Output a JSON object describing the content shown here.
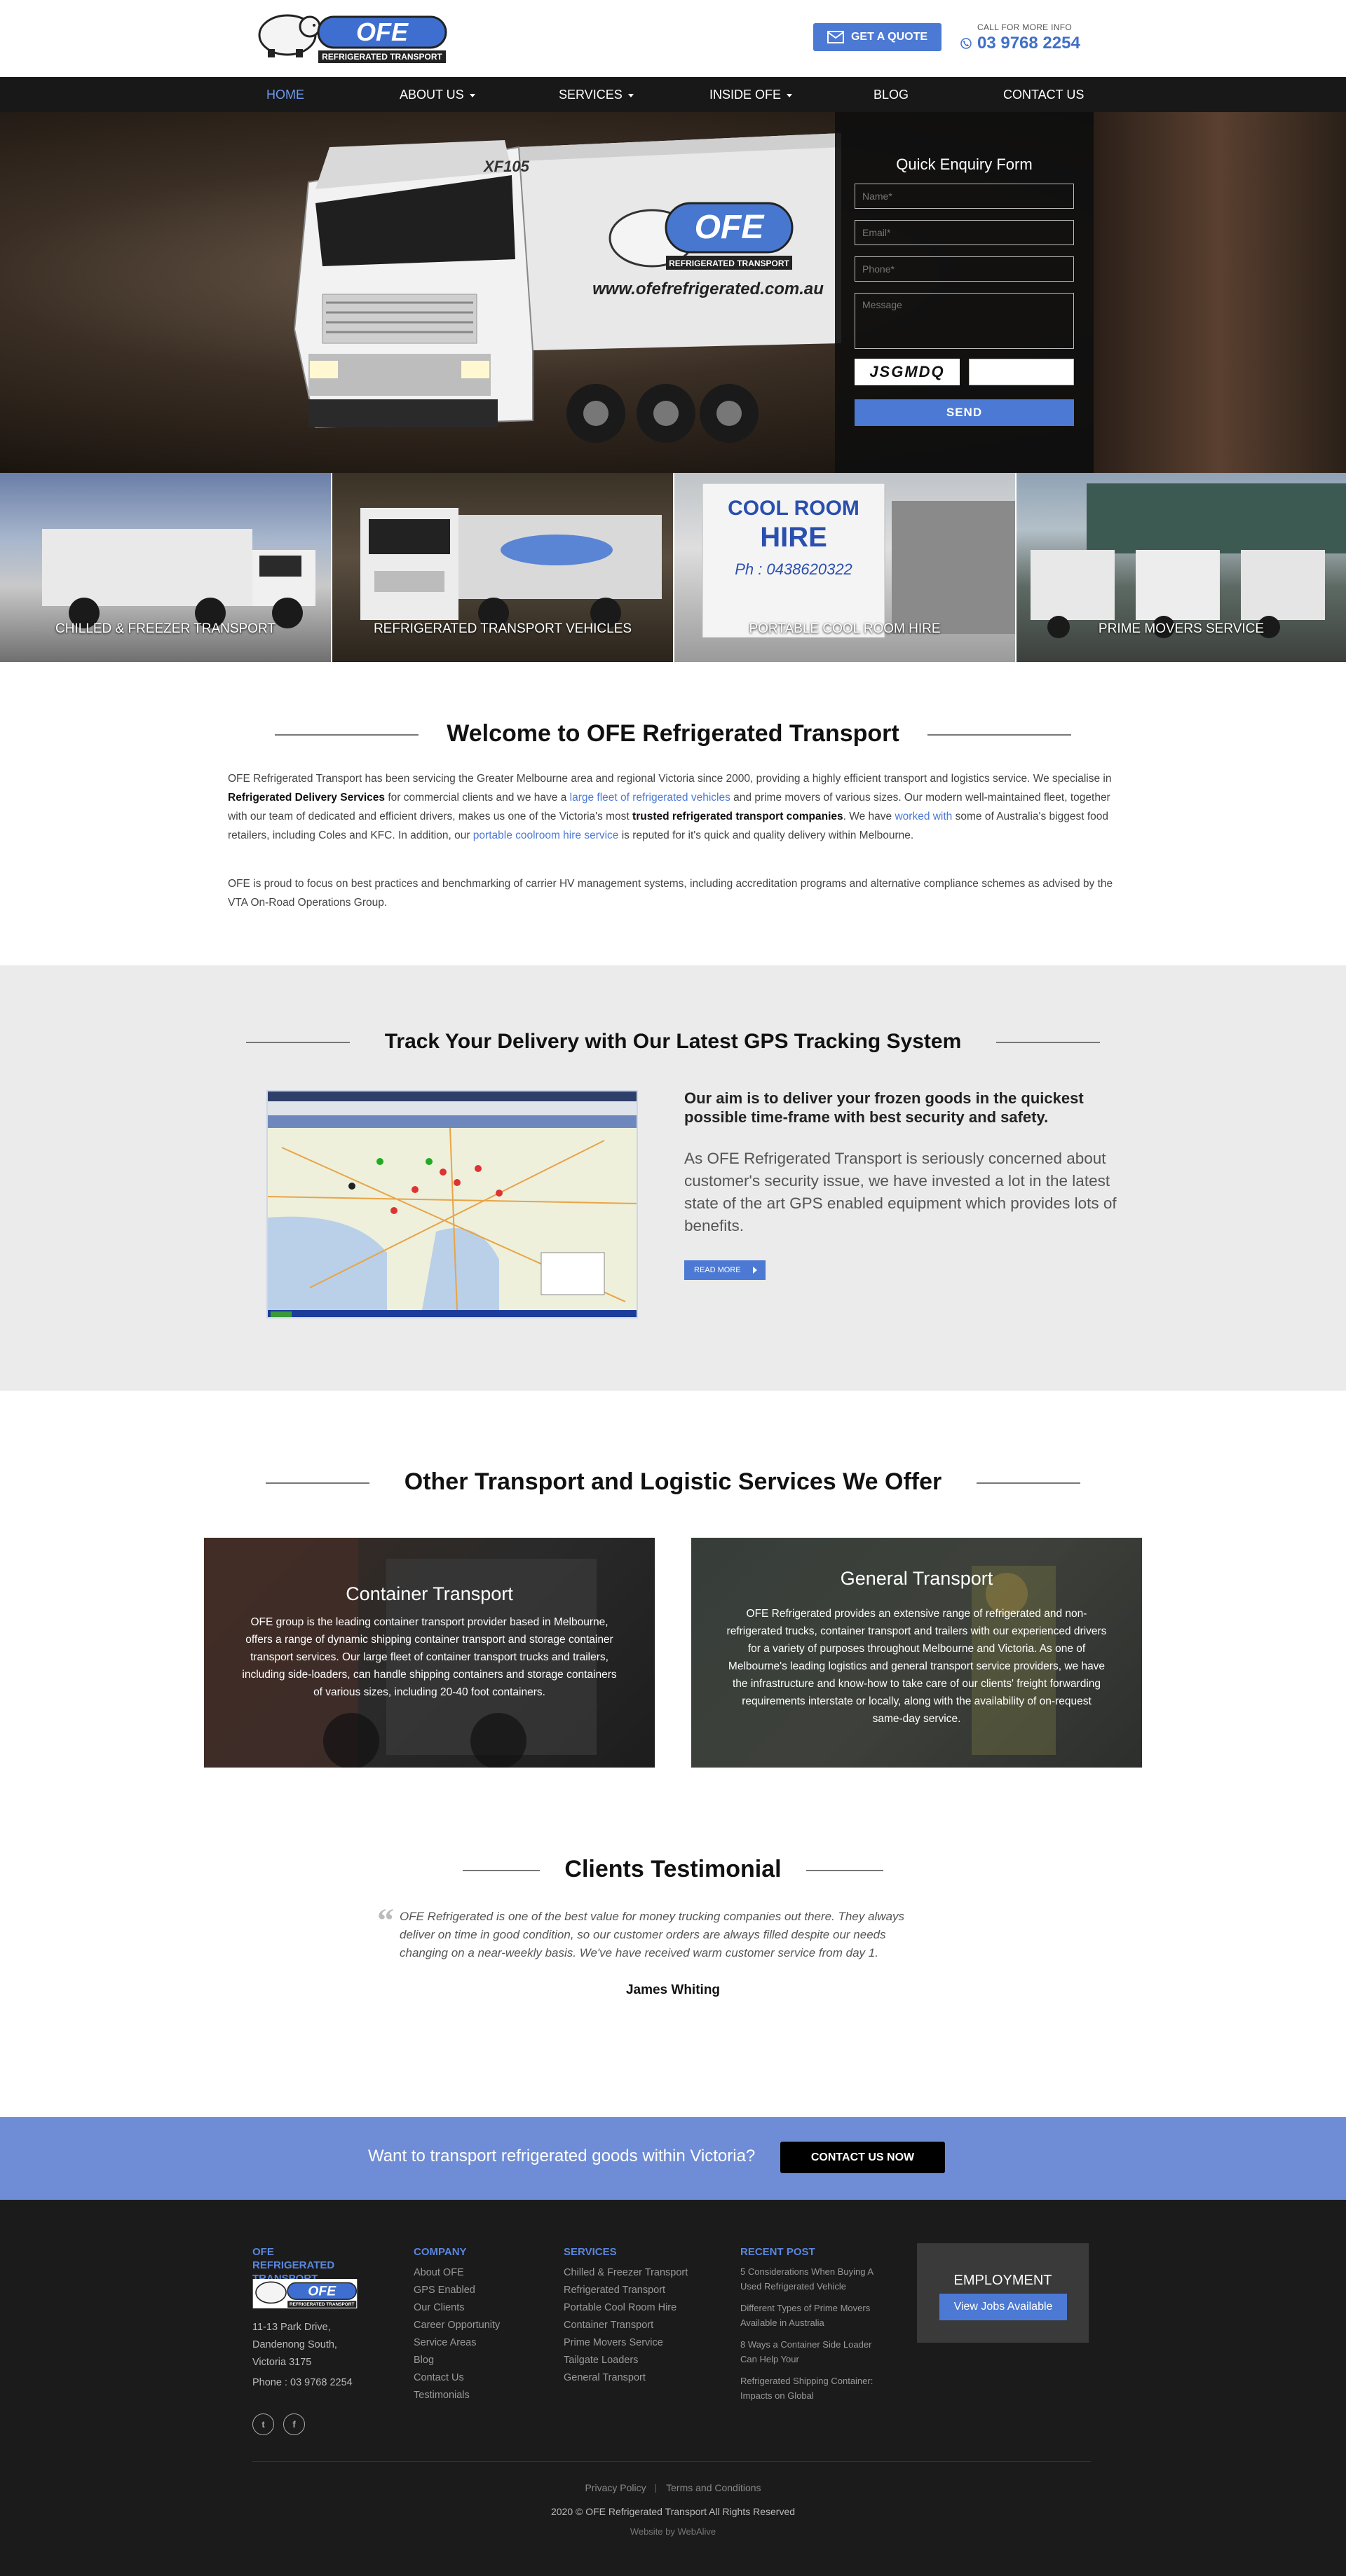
{
  "header": {
    "logo_text": "OFE",
    "logo_sub": "REFRIGERATED TRANSPORT",
    "quote_button": "GET A QUOTE",
    "call_label": "CALL FOR MORE INFO",
    "phone": "03 9768 2254"
  },
  "nav": {
    "items": [
      {
        "label": "HOME"
      },
      {
        "label": "ABOUT US"
      },
      {
        "label": "SERVICES"
      },
      {
        "label": "INSIDE OFE"
      },
      {
        "label": "BLOG"
      },
      {
        "label": "CONTACT US"
      }
    ]
  },
  "hero": {
    "truck_model": "XF105",
    "truck_url": "www.ofefrefrigerated.com.au",
    "enquiry": {
      "title": "Quick Enquiry Form",
      "name_placeholder": "Name*",
      "email_placeholder": "Email*",
      "phone_placeholder": "Phone*",
      "message_placeholder": "Message",
      "captcha": "JSGMDQ",
      "send_label": "SEND"
    }
  },
  "tiles": [
    {
      "label": "CHILLED & FREEZER TRANSPORT"
    },
    {
      "label": "REFRIGERATED TRANSPORT VEHICLES"
    },
    {
      "label": "PORTABLE COOL ROOM HIRE",
      "sign_title": "COOL ROOM",
      "sign_sub": "HIRE",
      "sign_phone": "Ph : 0438620322"
    },
    {
      "label": "PRIME MOVERS SERVICE"
    }
  ],
  "welcome": {
    "title": "Welcome to OFE Refrigerated Transport",
    "p1_a": "OFE Refrigerated Transport has been servicing the Greater Melbourne area and regional Victoria since 2000, providing a highly efficient transport and logistics service. We specialise in ",
    "p1_b": "Refrigerated Delivery Services",
    "p1_c": " for commercial clients and we have a ",
    "p1_link1": "large fleet of refrigerated vehicles",
    "p1_d": " and prime movers of various sizes. Our modern well-maintained fleet, together with our team of dedicated and efficient drivers, makes us one of the Victoria's most ",
    "p1_e": "trusted refrigerated transport companies",
    "p1_f": ". We have ",
    "p1_link2": "worked with",
    "p1_g": " some of Australia's biggest food retailers, including Coles and KFC. In addition, our ",
    "p1_link3": "portable coolroom hire service",
    "p1_h": " is reputed for it's quick and quality delivery within Melbourne.",
    "p2": "OFE is proud to focus on best practices and benchmarking of carrier HV management systems, including accreditation programs and alternative compliance schemes as advised by the VTA On-Road Operations Group."
  },
  "gps": {
    "title": "Track Your Delivery with Our Latest GPS Tracking System",
    "lead": "Our aim is to deliver your frozen goods in the quickest possible time-frame with best security and safety.",
    "body": "As OFE Refrigerated Transport is seriously concerned about customer's security issue, we have invested a lot in the latest state of the art GPS enabled equipment which provides lots of benefits.",
    "read_more": "READ MORE"
  },
  "services": {
    "title": "Other Transport and Logistic Services We Offer",
    "cards": [
      {
        "title": "Container Transport",
        "text": "OFE group is the leading container transport provider based in Melbourne, offers a range of dynamic shipping container transport and storage container transport services. Our large fleet of container transport trucks and trailers, including side-loaders, can handle shipping containers and storage containers of various sizes, including 20-40 foot containers."
      },
      {
        "title": "General Transport",
        "text": "OFE Refrigerated provides an extensive range of refrigerated and non-refrigerated trucks, container transport and trailers with our experienced drivers for a variety of purposes throughout Melbourne and Victoria. As one of Melbourne's leading logistics and general transport service providers, we have the infrastructure and know-how to take care of our clients' freight forwarding requirements interstate or locally, along with the availability of on-request same-day service."
      }
    ]
  },
  "testimonial": {
    "title": "Clients Testimonial",
    "quote": "OFE Refrigerated is one of the best value for money trucking companies out there. They always deliver on time in good condition, so our customer orders are always filled despite our needs changing on a near-weekly basis. We've have received warm customer service from day 1.",
    "author": "James Whiting"
  },
  "cta": {
    "text": "Want to transport refrigerated goods within Victoria?",
    "button": "CONTACT US NOW"
  },
  "footer": {
    "brand_head": "OFE REFRIGERATED TRANSPORT",
    "address_1": "11-13 Park Drive,",
    "address_2": "Dandenong South,",
    "address_3": "Victoria 3175",
    "phone": "Phone : 03 9768 2254",
    "company_head": "COMPANY",
    "company_links": [
      "About OFE",
      "GPS Enabled",
      "Our Clients",
      "Career Opportunity",
      "Service Areas",
      "Blog",
      "Contact Us",
      "Testimonials"
    ],
    "services_head": "SERVICES",
    "services_links": [
      "Chilled & Freezer Transport",
      "Refrigerated Transport",
      "Portable Cool Room Hire",
      "Container Transport",
      "Prime Movers Service",
      "Tailgate Loaders",
      "General Transport"
    ],
    "recent_head": "RECENT POST",
    "recent_posts": [
      "5 Considerations When Buying A Used Refrigerated Vehicle",
      "Different Types of Prime Movers Available in Australia",
      "8 Ways a Container Side Loader Can Help Your",
      "Refrigerated Shipping Container: Impacts on Global"
    ],
    "employment_title": "EMPLOYMENT",
    "employment_button": "View Jobs Available",
    "twitter": "t",
    "facebook": "f",
    "privacy": "Privacy Policy",
    "terms": "Terms and Conditions",
    "copyright": "2020 © OFE Refrigerated Transport All Rights Reserved",
    "credit": "Website by WebAlive"
  },
  "colors": {
    "accent": "#4c79d4",
    "nav_bg": "#181818",
    "cta_bg": "#6f8dd6",
    "footer_bg": "#1b1b1b"
  }
}
